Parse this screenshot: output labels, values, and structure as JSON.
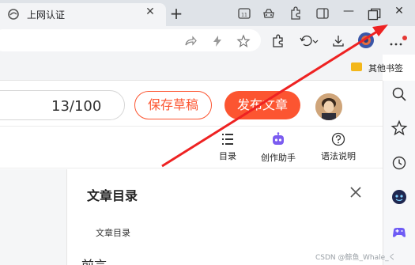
{
  "browser": {
    "tab": {
      "title": "上网认证"
    },
    "bookmarks": {
      "folder_label": "其他书签"
    }
  },
  "editor": {
    "title_counter": "13/100",
    "save_draft_label": "保存草稿",
    "publish_label": "发布文章",
    "toolbar": {
      "toc_label": "目录",
      "assistant_label": "创作助手",
      "syntax_label": "语法说明"
    },
    "toc_panel": {
      "title": "文章目录",
      "items": [
        "文章目录"
      ]
    },
    "content_heading": "前言"
  },
  "watermark": "CSDN @鲸鱼_Whale_く",
  "colors": {
    "accent": "#fc5531",
    "annotation_arrow": "#ee2222"
  }
}
